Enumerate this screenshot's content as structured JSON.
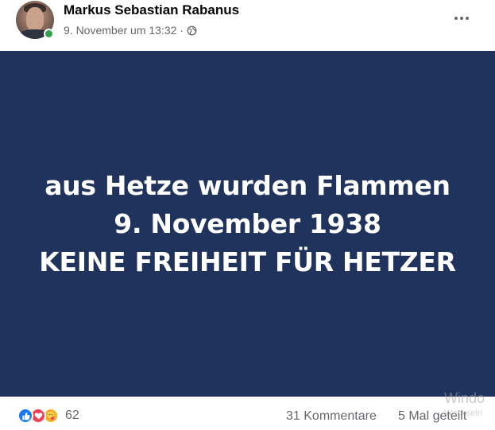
{
  "post": {
    "author_name": "Markus Sebastian Rabanus",
    "timestamp": "9. November um 13:32",
    "separator": "·",
    "privacy_icon": "globe-icon",
    "more_icon": "more-options-icon",
    "image": {
      "background_color": "#20335d",
      "text_color": "#ffffff",
      "lines": [
        "aus Hetze wurden Flammen",
        "9. November 1938",
        "KEINE FREIHEIT FÜR HETZER"
      ]
    },
    "reactions": {
      "icons": [
        "like-icon",
        "love-icon",
        "care-icon"
      ],
      "count": "62"
    },
    "comments_label": "31 Kommentare",
    "shares_label": "5 Mal geteilt"
  },
  "watermark": {
    "title": "Windo",
    "subtitle": "Wechseln"
  },
  "colors": {
    "accent": "#1877f2",
    "online": "#31a24c",
    "muted_text": "#65676b"
  }
}
